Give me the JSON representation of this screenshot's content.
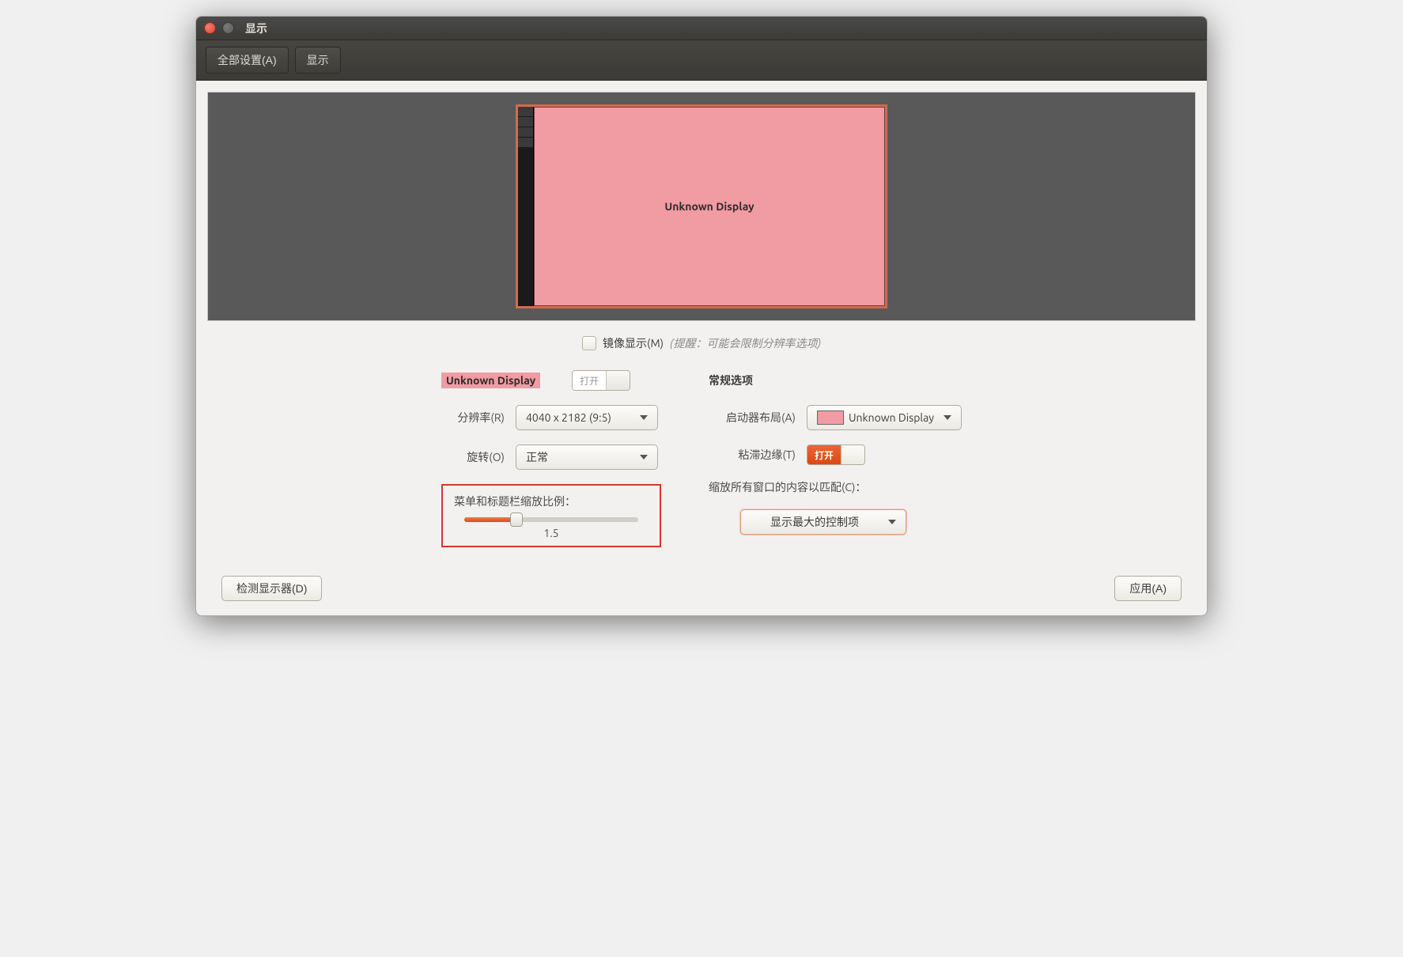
{
  "window": {
    "title": "显示"
  },
  "toolbar": {
    "all_settings": "全部设置(A)",
    "display": "显示"
  },
  "preview": {
    "display_name": "Unknown Display"
  },
  "mirror": {
    "label": "镜像显示(M)",
    "hint": "(提醒：可能会限制分辨率选项)"
  },
  "left": {
    "display_badge": "Unknown Display",
    "power_switch_label": "打开",
    "resolution_label": "分辨率(R)",
    "resolution_value": "4040 x 2182 (9:5)",
    "rotation_label": "旋转(O)",
    "rotation_value": "正常",
    "scale_title": "菜单和标题栏缩放比例：",
    "scale_value": "1.5"
  },
  "right": {
    "heading": "常规选项",
    "launcher_label": "启动器布局(A)",
    "launcher_value": "Unknown Display",
    "sticky_label": "粘滞边缘(T)",
    "sticky_switch": "打开",
    "scale_all_label": "缩放所有窗口的内容以匹配(C)：",
    "scale_all_value": "显示最大的控制项"
  },
  "actions": {
    "detect": "检测显示器(D)",
    "apply": "应用(A)"
  }
}
